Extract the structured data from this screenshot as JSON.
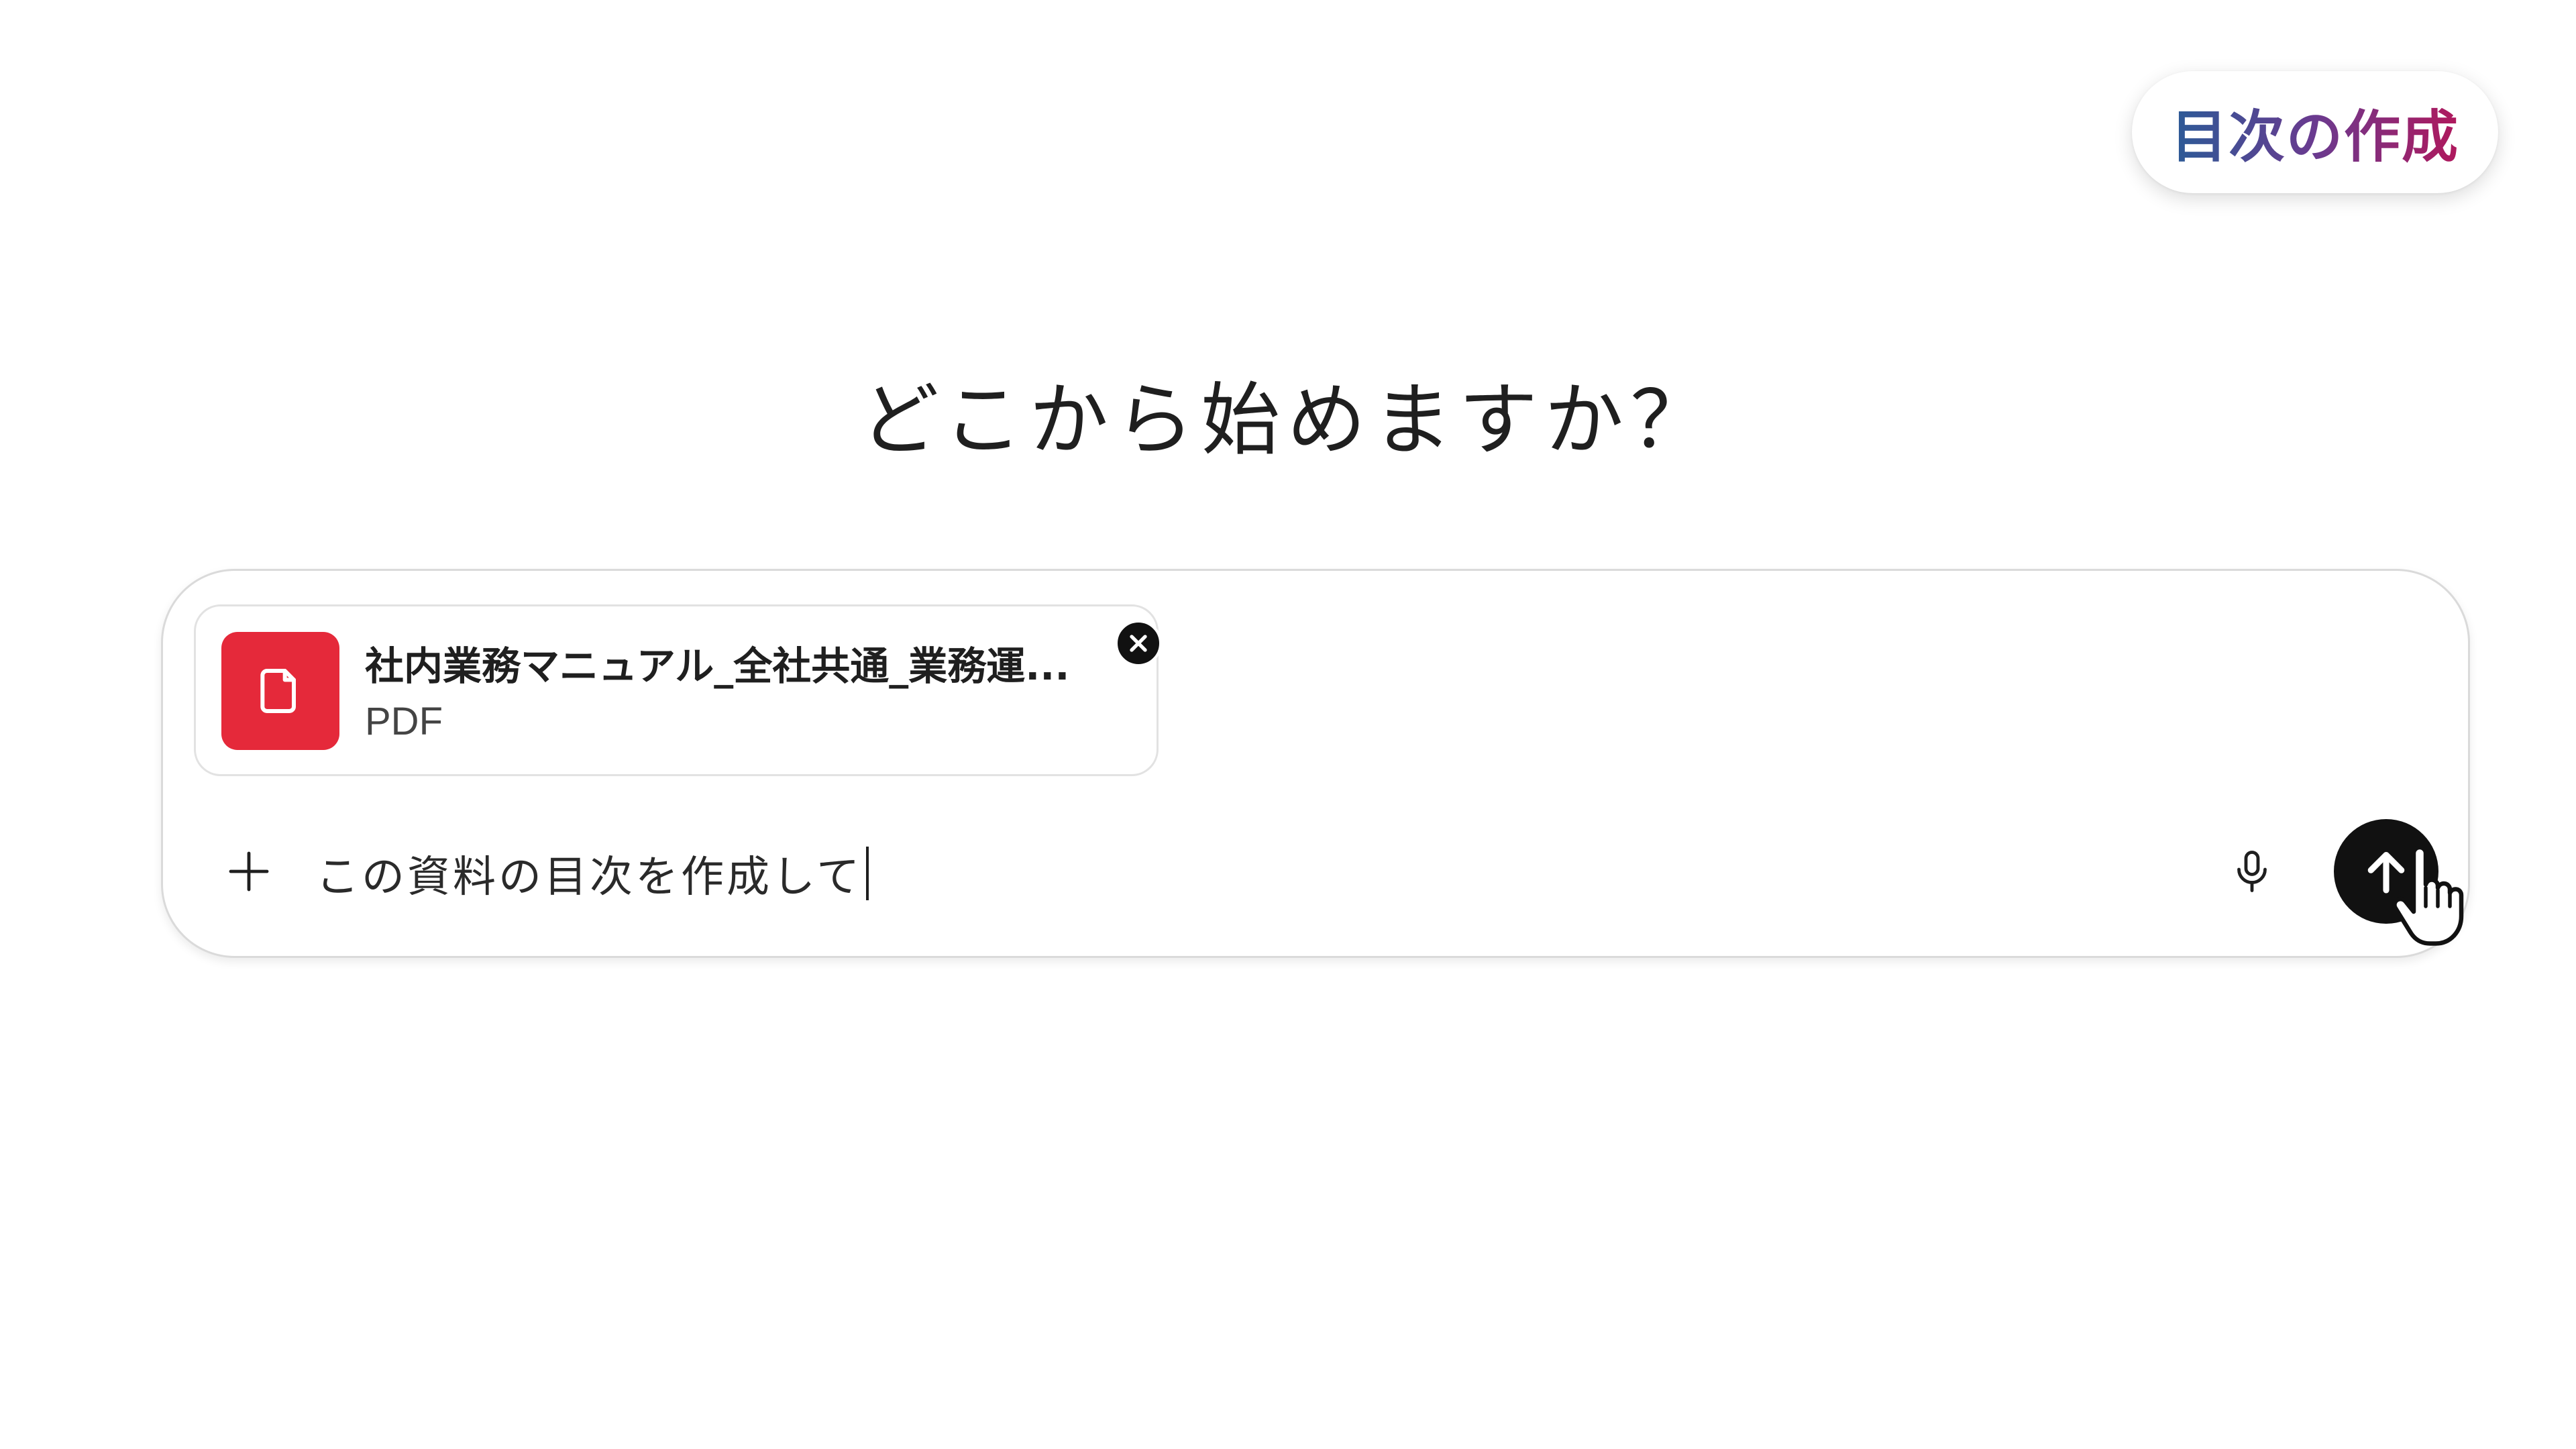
{
  "badge": {
    "label": "目次の作成",
    "gradient": [
      "#2b5b97",
      "#6a3a8f",
      "#b0185c"
    ]
  },
  "heading": "どこから始めますか？",
  "composer": {
    "attachment": {
      "name": "社内業務マニュアル_全社共通_業務運...",
      "type": "PDF",
      "icon": "document-icon",
      "icon_color": "#e5293a",
      "remove_icon": "close-icon"
    },
    "add_icon": "plus-icon",
    "input_value": "この資料の目次を作成して",
    "mic_icon": "microphone-icon",
    "send_icon": "arrow-up-icon",
    "send_color": "#111111"
  },
  "cursor": "hand-pointer-icon"
}
